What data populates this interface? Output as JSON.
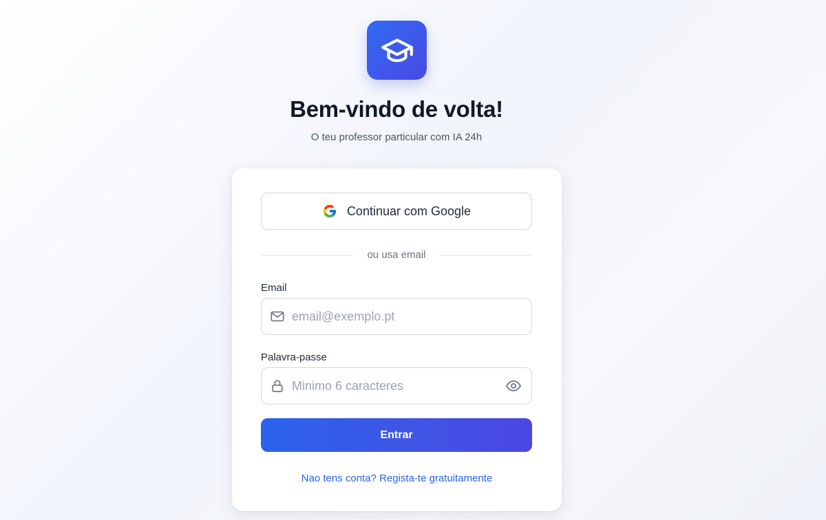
{
  "header": {
    "logo_icon": "graduation-cap-icon",
    "title": "Bem-vindo de volta!",
    "subtitle": "O teu professor particular com IA 24h"
  },
  "login": {
    "google_button": {
      "label": "Continuar com Google",
      "icon": "google-icon"
    },
    "divider_text": "ou usa email",
    "email": {
      "label": "Email",
      "placeholder": "email@exemplo.pt",
      "value": "",
      "icon": "mail-icon"
    },
    "password": {
      "label": "Palavra-passe",
      "placeholder": "Minimo 6 caracteres",
      "value": "",
      "icon": "lock-icon",
      "toggle_icon": "eye-icon"
    },
    "submit_label": "Entrar",
    "signup_link": "Nao tens conta? Regista-te gratuitamente"
  },
  "colors": {
    "accent_start": "#2a63ec",
    "accent_end": "#4c47e3",
    "link": "#2563eb",
    "title": "#111827"
  }
}
